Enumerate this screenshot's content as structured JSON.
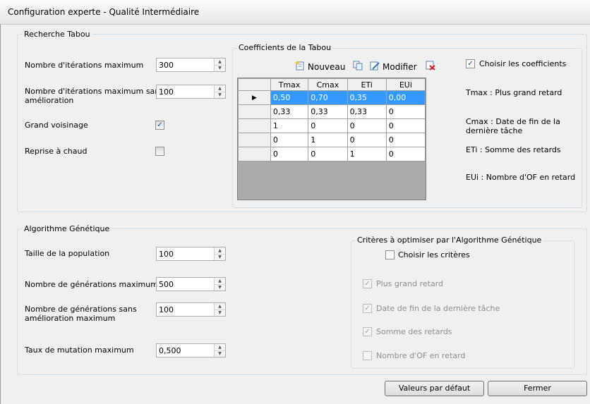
{
  "window": {
    "title": "Configuration experte - Qualité Intermédiaire"
  },
  "tabu": {
    "group_title": "Recherche Tabou",
    "max_iter_label": "Nombre d'itérations maximum",
    "max_iter_value": "300",
    "max_iter_noimp_label_1": "Nombre d'itérations maximum sans",
    "max_iter_noimp_label_2": "amélioration",
    "max_iter_noimp_value": "100",
    "neighborhood_label": "Grand voisinage",
    "neighborhood_checked": true,
    "warm_start_label": "Reprise à chaud",
    "warm_start_checked": false
  },
  "coeffs": {
    "group_title": "Coefficients de la Tabou",
    "new_label": "Nouveau",
    "edit_label": "Modifier",
    "choose_label": "Choisir les coefficients",
    "choose_checked": true,
    "columns": [
      "Tmax",
      "Cmax",
      "ETi",
      "EUi"
    ],
    "row_marker": "▶",
    "rows": [
      [
        "0,50",
        "0,70",
        "0,35",
        "0,00"
      ],
      [
        "0,33",
        "0,33",
        "0,33",
        "0"
      ],
      [
        "1",
        "0",
        "0",
        "0"
      ],
      [
        "0",
        "1",
        "0",
        "0"
      ],
      [
        "0",
        "0",
        "1",
        "0"
      ]
    ],
    "legend_tmax": "Tmax : Plus grand retard",
    "legend_cmax_1": "Cmax : Date de fin de la",
    "legend_cmax_2": "dernière tâche",
    "legend_eti": "ETi : Somme des retards",
    "legend_eui": "EUi : Nombre d'OF en retard"
  },
  "genetic": {
    "group_title": "Algorithme Génétique",
    "pop_label": "Taille de la population",
    "pop_value": "100",
    "max_gen_label": "Nombre de générations maximum",
    "max_gen_value": "500",
    "gen_noimp_label_1": "Nombre de générations sans",
    "gen_noimp_label_2": "amélioration maximum",
    "gen_noimp_value": "100",
    "mutation_label": "Taux de mutation maximum",
    "mutation_value": "0,500"
  },
  "criteria": {
    "group_title": "Critères à optimiser par l'Algorithme Génétique",
    "choose_label": "Choisir les critères",
    "choose_checked": false,
    "items": [
      {
        "label": "Plus grand retard",
        "checked": true
      },
      {
        "label": "Date de fin de la dernière tâche",
        "checked": true
      },
      {
        "label": "Somme des retards",
        "checked": true
      },
      {
        "label": "Nombre d'OF en retard",
        "checked": false
      }
    ]
  },
  "buttons": {
    "defaults": "Valeurs par défaut",
    "close": "Fermer"
  },
  "icons": {
    "spin_up": "▲",
    "spin_down": "▼",
    "check": "✓"
  }
}
